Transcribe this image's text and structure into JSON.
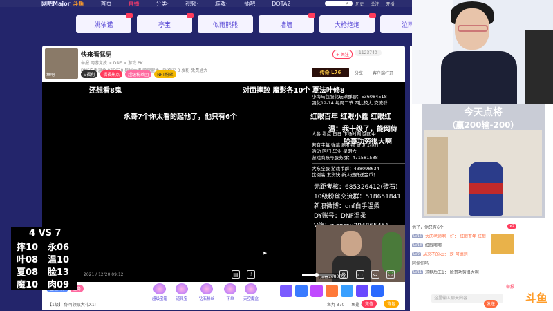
{
  "topnav": {
    "logo": "网吧Major",
    "items": [
      "首页",
      "直播",
      "分类·",
      "视频·",
      "游戏·",
      "插吧",
      "DOTA2"
    ],
    "active_index": 1,
    "mini": [
      "历史",
      "关注",
      "开播"
    ]
  },
  "categories": [
    "姚依诺",
    "亭宝",
    "似雨熊熊",
    "墙墙",
    "大枪炮炮",
    "泣雨"
  ],
  "room": {
    "title": "快来看猛男",
    "subtitle": "举报  网游竞技 > DNF > 游戏 PK",
    "line2": "DNF白手温柔  975670   异界大佬   荣耀盟主~PK你来   3 发粉   免费通大",
    "chips": [
      "V福利",
      "福福热点",
      "超级粉丝团",
      "NFT粉丝"
    ],
    "follow_label": "+ 关注",
    "follow_count": "1123740",
    "share_label": "分享",
    "client_label": "客户端打开",
    "sponsor": "传奇 L76",
    "avatar_tag": "鱼吧"
  },
  "video": {
    "captions": [
      "还想看8鬼",
      "对面摔跤  魔影各10个  夏法叶修8",
      "永哥7个你太看的起他了，他只有6个",
      "红眼百年  红眼小鑫  红眼红",
      "温：我十级了，能网侍",
      "脸哥功劳很大啊"
    ],
    "notice": [
      "小海马包服化玩球群聊：536084518",
      "强化12-14 每周二节 四比较大 交流群",
      "人各 看点 日日 下场时刻 回团中",
      "若有字幕 弹幕 刷礼物 进页 1小时",
      "活动  回归 毕业 星期六",
      "游戏商账号服务群：471581588",
      "大东全服 游戏币群：438098634",
      "比例高  发货快  新人进群送金币！"
    ],
    "info": [
      "无距考核：685326412(砖石)",
      "10级粉丝交流群：518651841",
      "新浪微博：dnf白手温柔",
      "DY账号：DNF温柔",
      "V信：wenrou294865456"
    ],
    "cam_label": "弹幕1080P60",
    "timestamp": "2021 / 12/20 09:12"
  },
  "controls": {
    "volume_fraction": 0.45
  },
  "gift_bar": {
    "pill1": "任务大厅",
    "pill2": "任务",
    "notice": "【1级】 你可领取大礼X1!",
    "buttons": [
      "超级宝箱",
      "道具宝",
      "钻石粉丝",
      "下单",
      "天空魔盒"
    ],
    "fish_count": "鱼丸 370",
    "coin_count": "鱼翅 0",
    "recharge": "充值",
    "send": "背包"
  },
  "scoreboard": {
    "head": "4 VS 7",
    "rows": [
      [
        "摔10",
        "永06"
      ],
      [
        "叶08",
        "温10"
      ],
      [
        "夏08",
        "脸13"
      ],
      [
        "魔10",
        "肉09"
      ]
    ]
  },
  "promo": {
    "title": "今天点将",
    "sub": "（赢200输-200）"
  },
  "chat": {
    "lines": [
      {
        "lv": "",
        "text": "他了，他只有6个"
      },
      {
        "lv": "LV16",
        "text": "大肉老师啊：好：  红眼百年  红眼"
      },
      {
        "lv": "LV18",
        "text": "红眼嘟嘟"
      },
      {
        "lv": "LV9",
        "text": "从来不的ko：  欢  阿德刺"
      },
      {
        "lv": "",
        "text": "阿偷你吗"
      },
      {
        "lv": "LV11",
        "text": "求糖后工1：  脸哥功劳很大啊"
      }
    ],
    "chest_badge": "x2",
    "input_placeholder": "这里输入聊天内容",
    "send_label": "发送",
    "report": "举报"
  },
  "brand": "斗鱼",
  "colors": {
    "bg": "#23256b",
    "accent": "#ff3b5c",
    "tab_text": "#5a4ad6"
  }
}
